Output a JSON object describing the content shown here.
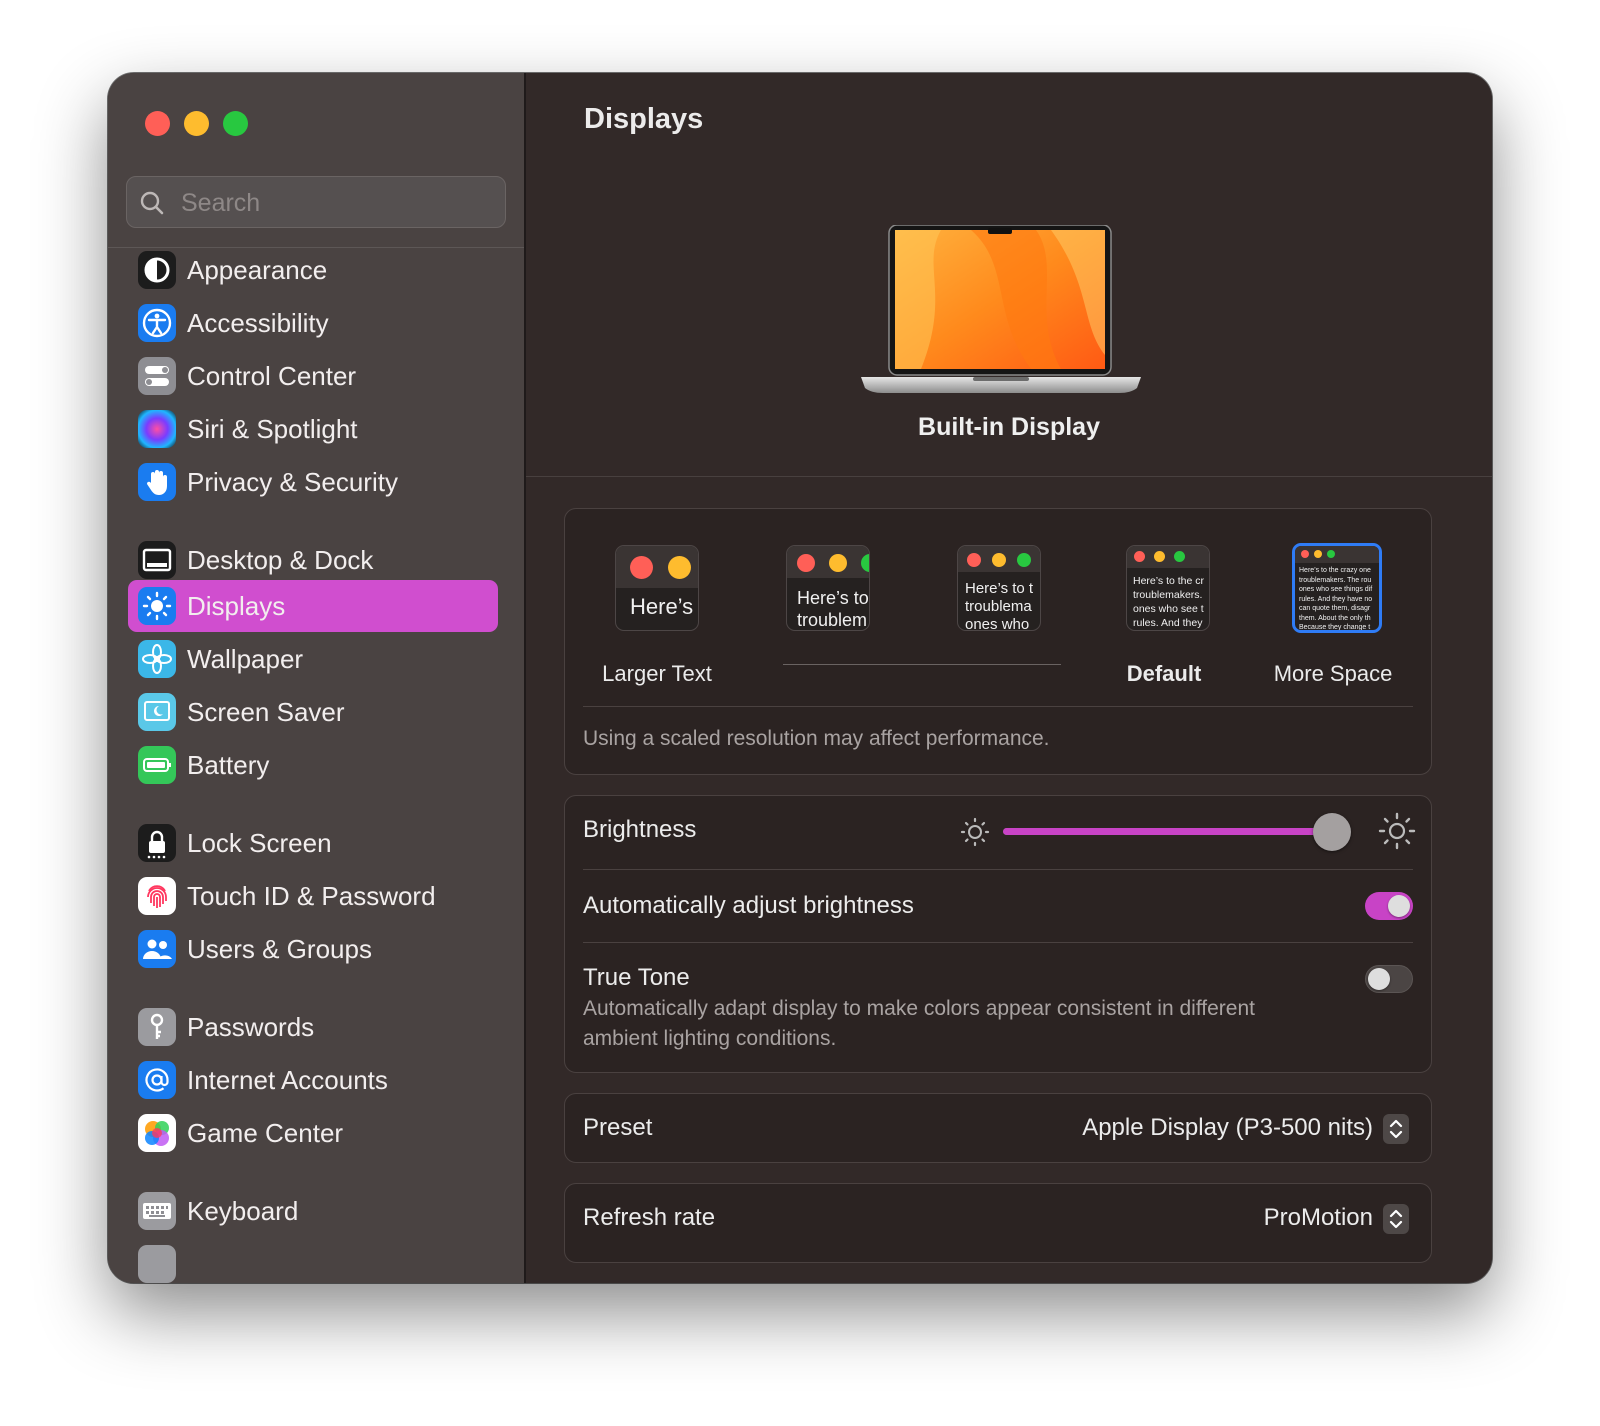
{
  "window": {
    "title": "Displays",
    "accent_color": "#d04ecf"
  },
  "sidebar": {
    "search": {
      "placeholder": "Search",
      "value": ""
    },
    "items": [
      {
        "label": "Appearance",
        "icon": "appearance-icon"
      },
      {
        "label": "Accessibility",
        "icon": "accessibility-icon"
      },
      {
        "label": "Control Center",
        "icon": "control-center-icon"
      },
      {
        "label": "Siri & Spotlight",
        "icon": "siri-icon"
      },
      {
        "label": "Privacy & Security",
        "icon": "hand-icon"
      },
      {
        "label": "Desktop & Dock",
        "icon": "desktop-dock-icon"
      },
      {
        "label": "Displays",
        "icon": "sun-icon",
        "selected": true
      },
      {
        "label": "Wallpaper",
        "icon": "flower-icon"
      },
      {
        "label": "Screen Saver",
        "icon": "screen-saver-icon"
      },
      {
        "label": "Battery",
        "icon": "battery-icon"
      },
      {
        "label": "Lock Screen",
        "icon": "lock-icon"
      },
      {
        "label": "Touch ID & Password",
        "icon": "fingerprint-icon"
      },
      {
        "label": "Users & Groups",
        "icon": "users-icon"
      },
      {
        "label": "Passwords",
        "icon": "key-icon"
      },
      {
        "label": "Internet Accounts",
        "icon": "at-sign-icon"
      },
      {
        "label": "Game Center",
        "icon": "game-center-icon"
      },
      {
        "label": "Keyboard",
        "icon": "keyboard-icon"
      }
    ]
  },
  "main": {
    "title": "Displays",
    "display_name": "Built-in Display",
    "resolution": {
      "options": [
        {
          "label": "Larger Text",
          "sample": "Here’s"
        },
        {
          "label": "",
          "sample": "Here’s to\ntroublem"
        },
        {
          "label": "",
          "sample": "Here’s to t\ntroublema\nones who"
        },
        {
          "label": "Default",
          "sample": "Here’s to the cr\ntroublemakers.\nones who see t\nrules. And they"
        },
        {
          "label": "More Space",
          "sample": "Here’s to the crazy one\ntroublemakers. The rou\nones who see things dif\nrules. And they have no\ncan quote them, disagr\nthem. About the only th\nBecause they change t",
          "selected": true
        }
      ],
      "note": "Using a scaled resolution may affect performance."
    },
    "brightness": {
      "label": "Brightness",
      "value": 0.95
    },
    "auto_brightness": {
      "label": "Automatically adjust brightness",
      "on": true
    },
    "true_tone": {
      "label": "True Tone",
      "description": "Automatically adapt display to make colors appear consistent in different ambient lighting conditions.",
      "on": false
    },
    "preset": {
      "label": "Preset",
      "value": "Apple Display (P3-500 nits)"
    },
    "refresh_rate": {
      "label": "Refresh rate",
      "value": "ProMotion"
    }
  }
}
